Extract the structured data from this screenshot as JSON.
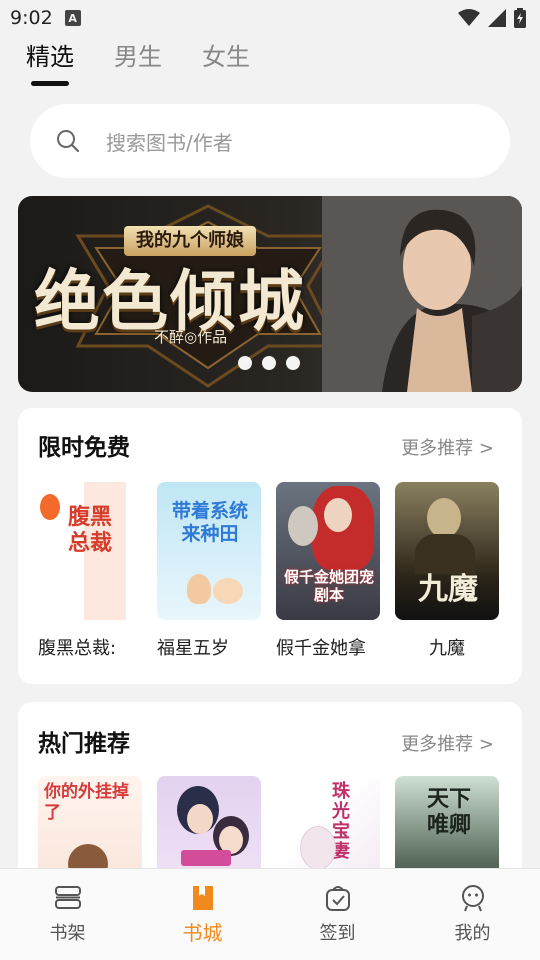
{
  "status_bar": {
    "time": "9:02",
    "notification_letter": "A"
  },
  "top_tabs": [
    {
      "label": "精选",
      "active": true
    },
    {
      "label": "男生",
      "active": false
    },
    {
      "label": "女生",
      "active": false
    }
  ],
  "search": {
    "placeholder": "搜索图书/作者"
  },
  "banner": {
    "subtitle": "我的九个师娘",
    "title": "绝色倾城",
    "author": "不醉◎作品",
    "dots": 3
  },
  "free_section": {
    "title": "限时免费",
    "more": "更多推荐 >",
    "books": [
      {
        "name": "腹黑总裁:",
        "cover_text": "腹黑总裁"
      },
      {
        "name": "福星五岁",
        "cover_text": "带着系统来种田"
      },
      {
        "name": "假千金她拿",
        "cover_text": "假千金她团宠剧本"
      },
      {
        "name": "九魔",
        "cover_text": "九魔"
      }
    ]
  },
  "hot_section": {
    "title": "热门推荐",
    "more": "更多推荐 >",
    "books": [
      {
        "cover_text": "你的外挂掉了"
      },
      {
        "cover_text": ""
      },
      {
        "cover_text": "珠光宝妻"
      },
      {
        "cover_text": "天下唯卿"
      }
    ]
  },
  "bottom_nav": [
    {
      "label": "书架",
      "icon": "bookshelf-icon",
      "active": false
    },
    {
      "label": "书城",
      "icon": "bookstore-icon",
      "active": true
    },
    {
      "label": "签到",
      "icon": "checkin-icon",
      "active": false
    },
    {
      "label": "我的",
      "icon": "profile-icon",
      "active": false
    }
  ],
  "colors": {
    "accent": "#f08a1c",
    "background": "#f2f2f2"
  }
}
